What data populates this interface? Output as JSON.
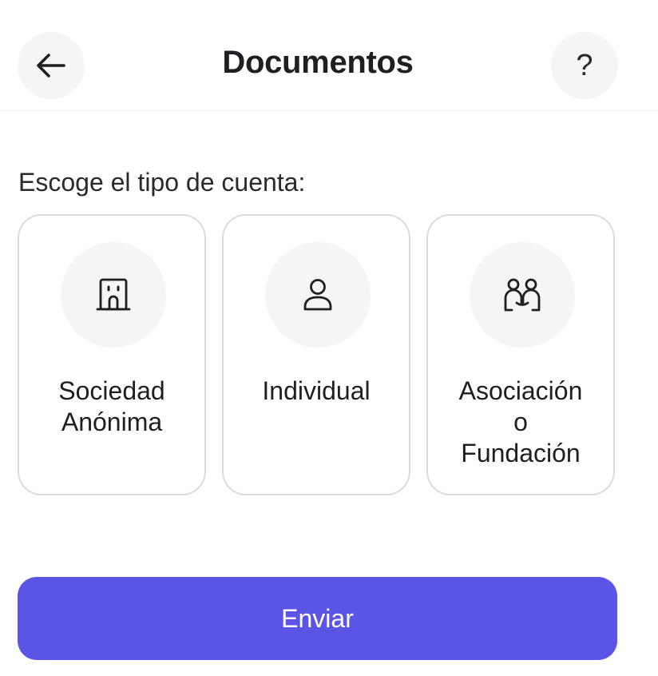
{
  "header": {
    "title": "Documentos",
    "back_icon": "arrow-left-icon",
    "help_label": "?"
  },
  "prompt": "Escoge el tipo de cuenta:",
  "account_types": [
    {
      "label_lines": [
        "Sociedad",
        "Anónima"
      ],
      "icon": "building-icon"
    },
    {
      "label_lines": [
        "Individual"
      ],
      "icon": "user-icon"
    },
    {
      "label_lines": [
        "Asociación",
        "o",
        "Fundación"
      ],
      "icon": "people-icon"
    }
  ],
  "submit_label": "Enviar",
  "colors": {
    "primary": "#5b55e6",
    "card_border": "#dcdce0",
    "icon_bg": "#f5f5f7",
    "text": "#1f1f23"
  }
}
